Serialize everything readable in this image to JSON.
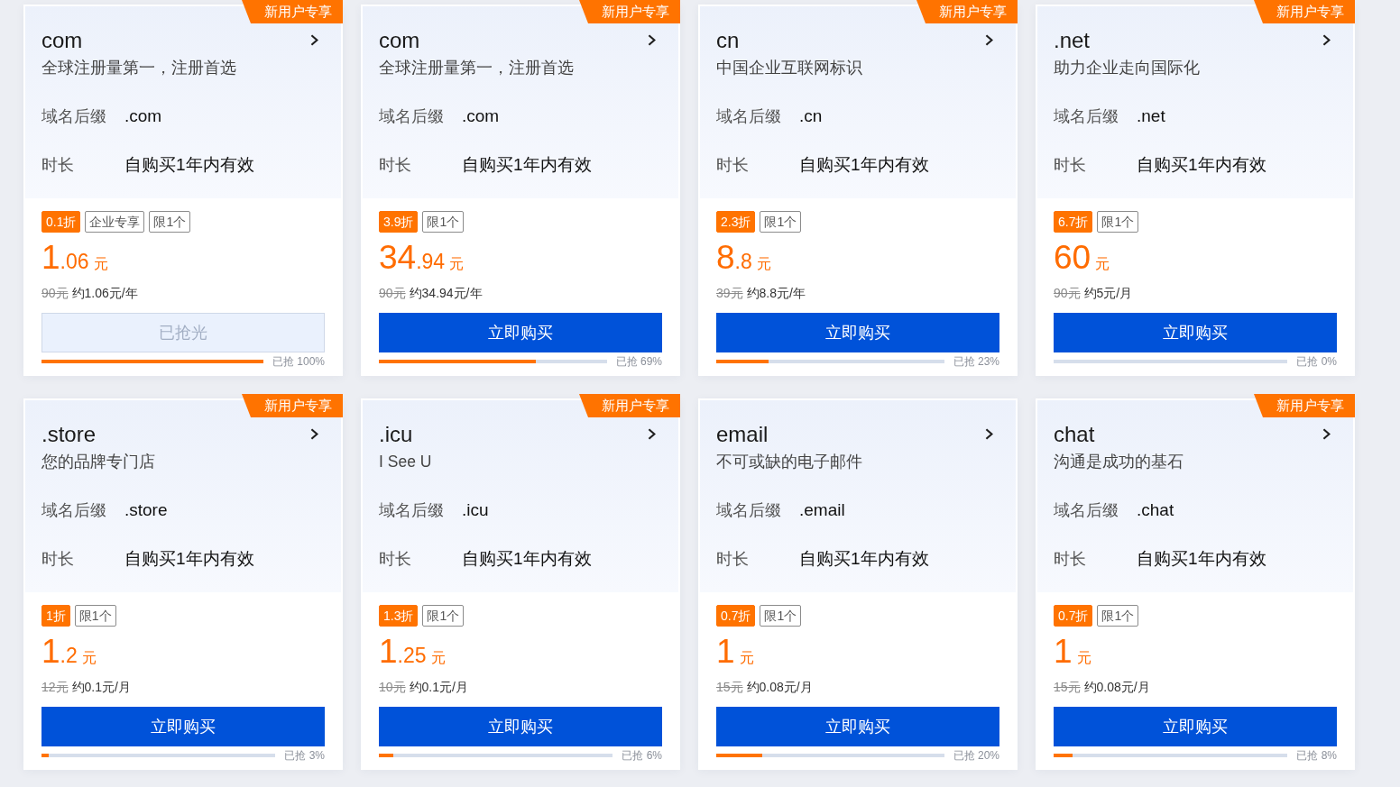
{
  "cards": [
    {
      "ribbon": "新用户专享",
      "title": "com",
      "description": "全球注册量第一，注册首选",
      "fields": [
        {
          "label": "域名后缀",
          "value": ".com"
        },
        {
          "label": "时长",
          "value": "自购买1年内有效"
        }
      ],
      "tags": [
        {
          "kind": "discount",
          "text": "0.1折"
        },
        {
          "kind": "outline",
          "text": "企业专享"
        },
        {
          "kind": "outline",
          "text": "限1个"
        }
      ],
      "price": {
        "whole": "1",
        "fraction": ".06",
        "unit": "元"
      },
      "original_price": "90元",
      "unit_price": "约1.06元/年",
      "button": {
        "label": "已抢光",
        "disabled": true
      },
      "sold": {
        "label": "已抢 100%",
        "level": 1
      }
    },
    {
      "ribbon": "新用户专享",
      "title": "com",
      "description": "全球注册量第一，注册首选",
      "fields": [
        {
          "label": "域名后缀",
          "value": ".com"
        },
        {
          "label": "时长",
          "value": "自购买1年内有效"
        }
      ],
      "tags": [
        {
          "kind": "discount",
          "text": "3.9折"
        },
        {
          "kind": "outline",
          "text": "限1个"
        }
      ],
      "price": {
        "whole": "34",
        "fraction": ".94",
        "unit": "元"
      },
      "original_price": "90元",
      "unit_price": "约34.94元/年",
      "button": {
        "label": "立即购买",
        "disabled": false
      },
      "sold": {
        "label": "已抢 69%",
        "level": 0.69
      }
    },
    {
      "ribbon": "新用户专享",
      "title": "cn",
      "description": "中国企业互联网标识",
      "fields": [
        {
          "label": "域名后缀",
          "value": ".cn"
        },
        {
          "label": "时长",
          "value": "自购买1年内有效"
        }
      ],
      "tags": [
        {
          "kind": "discount",
          "text": "2.3折"
        },
        {
          "kind": "outline",
          "text": "限1个"
        }
      ],
      "price": {
        "whole": "8",
        "fraction": ".8",
        "unit": "元"
      },
      "original_price": "39元",
      "unit_price": "约8.8元/年",
      "button": {
        "label": "立即购买",
        "disabled": false
      },
      "sold": {
        "label": "已抢 23%",
        "level": 0.23
      }
    },
    {
      "ribbon": "新用户专享",
      "title": ".net",
      "description": "助力企业走向国际化",
      "fields": [
        {
          "label": "域名后缀",
          "value": ".net"
        },
        {
          "label": "时长",
          "value": "自购买1年内有效"
        }
      ],
      "tags": [
        {
          "kind": "discount",
          "text": "6.7折"
        },
        {
          "kind": "outline",
          "text": "限1个"
        }
      ],
      "price": {
        "whole": "60",
        "unit": "元"
      },
      "original_price": "90元",
      "unit_price": "约5元/月",
      "button": {
        "label": "立即购买",
        "disabled": false
      },
      "sold": {
        "label": "已抢 0%",
        "level": 0
      }
    },
    {
      "ribbon": "新用户专享",
      "title": ".store",
      "description": "您的品牌专门店",
      "fields": [
        {
          "label": "域名后缀",
          "value": ".store"
        },
        {
          "label": "时长",
          "value": "自购买1年内有效"
        }
      ],
      "tags": [
        {
          "kind": "discount",
          "text": "1折"
        },
        {
          "kind": "outline",
          "text": "限1个"
        }
      ],
      "price": {
        "whole": "1",
        "fraction": ".2",
        "unit": "元"
      },
      "original_price": "12元",
      "unit_price": "约0.1元/月",
      "button": {
        "label": "立即购买",
        "disabled": false
      },
      "sold": {
        "label": "已抢 3%",
        "level": 0.03
      }
    },
    {
      "ribbon": "新用户专享",
      "title": ".icu",
      "description": "I See U",
      "fields": [
        {
          "label": "域名后缀",
          "value": ".icu"
        },
        {
          "label": "时长",
          "value": "自购买1年内有效"
        }
      ],
      "tags": [
        {
          "kind": "discount",
          "text": "1.3折"
        },
        {
          "kind": "outline",
          "text": "限1个"
        }
      ],
      "price": {
        "whole": "1",
        "fraction": ".25",
        "unit": "元"
      },
      "original_price": "10元",
      "unit_price": "约0.1元/月",
      "button": {
        "label": "立即购买",
        "disabled": false
      },
      "sold": {
        "label": "已抢 6%",
        "level": 0.06
      }
    },
    {
      "title": "email",
      "description": "不可或缺的电子邮件",
      "fields": [
        {
          "label": "域名后缀",
          "value": ".email"
        },
        {
          "label": "时长",
          "value": "自购买1年内有效"
        }
      ],
      "tags": [
        {
          "kind": "discount",
          "text": "0.7折"
        },
        {
          "kind": "outline",
          "text": "限1个"
        }
      ],
      "price": {
        "whole": "1",
        "unit": "元"
      },
      "original_price": "15元",
      "unit_price": "约0.08元/月",
      "button": {
        "label": "立即购买",
        "disabled": false
      },
      "sold": {
        "label": "已抢 20%",
        "level": 0.2
      }
    },
    {
      "ribbon": "新用户专享",
      "title": "chat",
      "description": "沟通是成功的基石",
      "fields": [
        {
          "label": "域名后缀",
          "value": ".chat"
        },
        {
          "label": "时长",
          "value": "自购买1年内有效"
        }
      ],
      "tags": [
        {
          "kind": "discount",
          "text": "0.7折"
        },
        {
          "kind": "outline",
          "text": "限1个"
        }
      ],
      "price": {
        "whole": "1",
        "unit": "元"
      },
      "original_price": "15元",
      "unit_price": "约0.08元/月",
      "button": {
        "label": "立即购买",
        "disabled": false
      },
      "sold": {
        "label": "已抢 8%",
        "level": 0.08
      }
    }
  ]
}
